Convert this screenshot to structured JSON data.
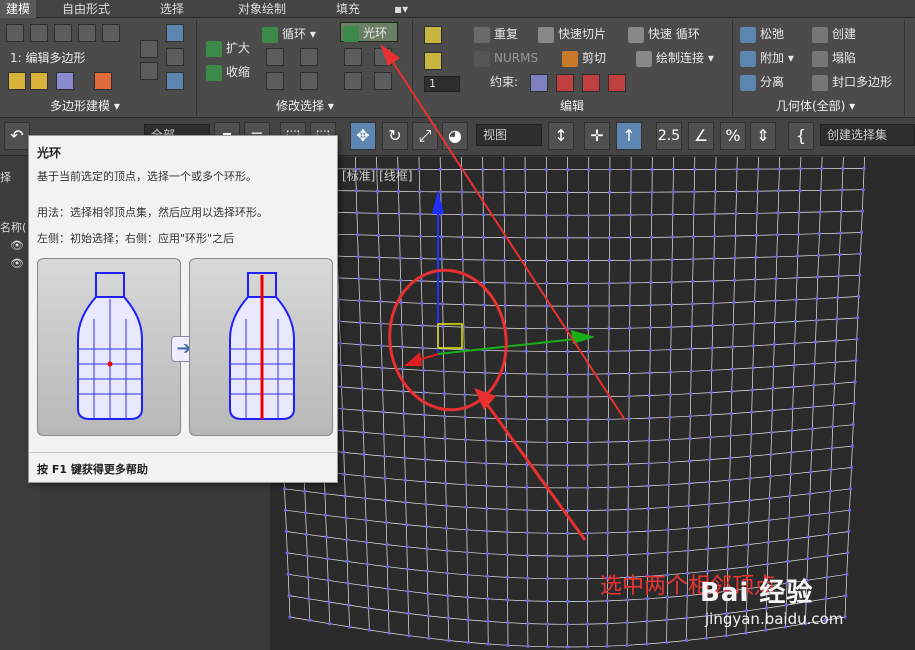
{
  "tabs": [
    "建模",
    "自由形式",
    "选择",
    "对象绘制",
    "填充"
  ],
  "ribbon": {
    "poly_group": {
      "object_label": "1: 编辑多边形",
      "group_label": "多边形建模 ▾"
    },
    "modify_group": {
      "grow": "扩大",
      "shrink": "收缩",
      "loop": "循环",
      "ring": "光环",
      "group_label": "修改选择 ▾"
    },
    "edit_group": {
      "repeat": "重复",
      "quickslice": "快速切片",
      "quickloop": "快速 循环",
      "nurms": "NURMS",
      "cut": "剪切",
      "paintconnect": "绘制连接",
      "constraint": "约束:",
      "spinner_value": "1",
      "group_label": "编辑"
    },
    "geometry_group": {
      "relax": "松弛",
      "create": "创建",
      "attach": "附加",
      "collapse": "塌陷",
      "detach": "分离",
      "cap": "封口多边形",
      "group_label": "几何体(全部) ▾"
    }
  },
  "toolbar": {
    "filter_combo": "全部",
    "view_combo": "视图",
    "selection_set": "创建选择集",
    "angle_snap": "2.5"
  },
  "viewport": {
    "label": "[标准] [线框]"
  },
  "tooltip": {
    "title": "光环",
    "desc": "基于当前选定的顶点，选择一个或多个环形。",
    "usage": "用法：选择相邻顶点集，然后应用以选择环形。",
    "sides": "左侧：初始选择；右侧：应用\"环形\"之后",
    "footer": "按 F1 键获得更多帮助"
  },
  "left_panel": {
    "label1": "名称(",
    "label2": "择"
  },
  "annotation": {
    "caption": "选中两个相邻顶点"
  },
  "watermark": {
    "brand": "Bai 经验",
    "url": "jingyan.baidu.com"
  },
  "colors": {
    "accent_blue": "#5c86b0",
    "annotation_red": "#e83030",
    "vertex_blue": "#6a6af0"
  }
}
